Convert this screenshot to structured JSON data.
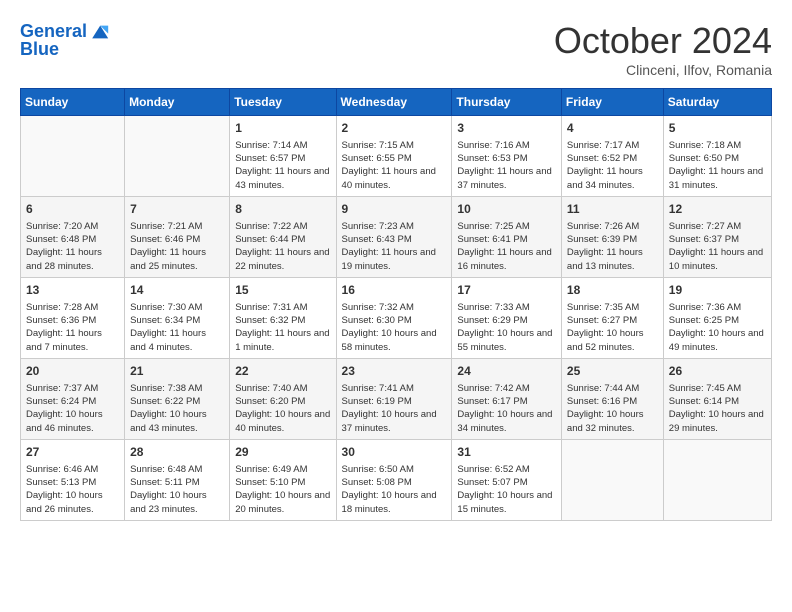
{
  "header": {
    "logo_line1": "General",
    "logo_line2": "Blue",
    "month": "October 2024",
    "location": "Clinceni, Ilfov, Romania"
  },
  "days_of_week": [
    "Sunday",
    "Monday",
    "Tuesday",
    "Wednesday",
    "Thursday",
    "Friday",
    "Saturday"
  ],
  "weeks": [
    [
      {
        "day": "",
        "info": ""
      },
      {
        "day": "",
        "info": ""
      },
      {
        "day": "1",
        "info": "Sunrise: 7:14 AM\nSunset: 6:57 PM\nDaylight: 11 hours and 43 minutes."
      },
      {
        "day": "2",
        "info": "Sunrise: 7:15 AM\nSunset: 6:55 PM\nDaylight: 11 hours and 40 minutes."
      },
      {
        "day": "3",
        "info": "Sunrise: 7:16 AM\nSunset: 6:53 PM\nDaylight: 11 hours and 37 minutes."
      },
      {
        "day": "4",
        "info": "Sunrise: 7:17 AM\nSunset: 6:52 PM\nDaylight: 11 hours and 34 minutes."
      },
      {
        "day": "5",
        "info": "Sunrise: 7:18 AM\nSunset: 6:50 PM\nDaylight: 11 hours and 31 minutes."
      }
    ],
    [
      {
        "day": "6",
        "info": "Sunrise: 7:20 AM\nSunset: 6:48 PM\nDaylight: 11 hours and 28 minutes."
      },
      {
        "day": "7",
        "info": "Sunrise: 7:21 AM\nSunset: 6:46 PM\nDaylight: 11 hours and 25 minutes."
      },
      {
        "day": "8",
        "info": "Sunrise: 7:22 AM\nSunset: 6:44 PM\nDaylight: 11 hours and 22 minutes."
      },
      {
        "day": "9",
        "info": "Sunrise: 7:23 AM\nSunset: 6:43 PM\nDaylight: 11 hours and 19 minutes."
      },
      {
        "day": "10",
        "info": "Sunrise: 7:25 AM\nSunset: 6:41 PM\nDaylight: 11 hours and 16 minutes."
      },
      {
        "day": "11",
        "info": "Sunrise: 7:26 AM\nSunset: 6:39 PM\nDaylight: 11 hours and 13 minutes."
      },
      {
        "day": "12",
        "info": "Sunrise: 7:27 AM\nSunset: 6:37 PM\nDaylight: 11 hours and 10 minutes."
      }
    ],
    [
      {
        "day": "13",
        "info": "Sunrise: 7:28 AM\nSunset: 6:36 PM\nDaylight: 11 hours and 7 minutes."
      },
      {
        "day": "14",
        "info": "Sunrise: 7:30 AM\nSunset: 6:34 PM\nDaylight: 11 hours and 4 minutes."
      },
      {
        "day": "15",
        "info": "Sunrise: 7:31 AM\nSunset: 6:32 PM\nDaylight: 11 hours and 1 minute."
      },
      {
        "day": "16",
        "info": "Sunrise: 7:32 AM\nSunset: 6:30 PM\nDaylight: 10 hours and 58 minutes."
      },
      {
        "day": "17",
        "info": "Sunrise: 7:33 AM\nSunset: 6:29 PM\nDaylight: 10 hours and 55 minutes."
      },
      {
        "day": "18",
        "info": "Sunrise: 7:35 AM\nSunset: 6:27 PM\nDaylight: 10 hours and 52 minutes."
      },
      {
        "day": "19",
        "info": "Sunrise: 7:36 AM\nSunset: 6:25 PM\nDaylight: 10 hours and 49 minutes."
      }
    ],
    [
      {
        "day": "20",
        "info": "Sunrise: 7:37 AM\nSunset: 6:24 PM\nDaylight: 10 hours and 46 minutes."
      },
      {
        "day": "21",
        "info": "Sunrise: 7:38 AM\nSunset: 6:22 PM\nDaylight: 10 hours and 43 minutes."
      },
      {
        "day": "22",
        "info": "Sunrise: 7:40 AM\nSunset: 6:20 PM\nDaylight: 10 hours and 40 minutes."
      },
      {
        "day": "23",
        "info": "Sunrise: 7:41 AM\nSunset: 6:19 PM\nDaylight: 10 hours and 37 minutes."
      },
      {
        "day": "24",
        "info": "Sunrise: 7:42 AM\nSunset: 6:17 PM\nDaylight: 10 hours and 34 minutes."
      },
      {
        "day": "25",
        "info": "Sunrise: 7:44 AM\nSunset: 6:16 PM\nDaylight: 10 hours and 32 minutes."
      },
      {
        "day": "26",
        "info": "Sunrise: 7:45 AM\nSunset: 6:14 PM\nDaylight: 10 hours and 29 minutes."
      }
    ],
    [
      {
        "day": "27",
        "info": "Sunrise: 6:46 AM\nSunset: 5:13 PM\nDaylight: 10 hours and 26 minutes."
      },
      {
        "day": "28",
        "info": "Sunrise: 6:48 AM\nSunset: 5:11 PM\nDaylight: 10 hours and 23 minutes."
      },
      {
        "day": "29",
        "info": "Sunrise: 6:49 AM\nSunset: 5:10 PM\nDaylight: 10 hours and 20 minutes."
      },
      {
        "day": "30",
        "info": "Sunrise: 6:50 AM\nSunset: 5:08 PM\nDaylight: 10 hours and 18 minutes."
      },
      {
        "day": "31",
        "info": "Sunrise: 6:52 AM\nSunset: 5:07 PM\nDaylight: 10 hours and 15 minutes."
      },
      {
        "day": "",
        "info": ""
      },
      {
        "day": "",
        "info": ""
      }
    ]
  ]
}
